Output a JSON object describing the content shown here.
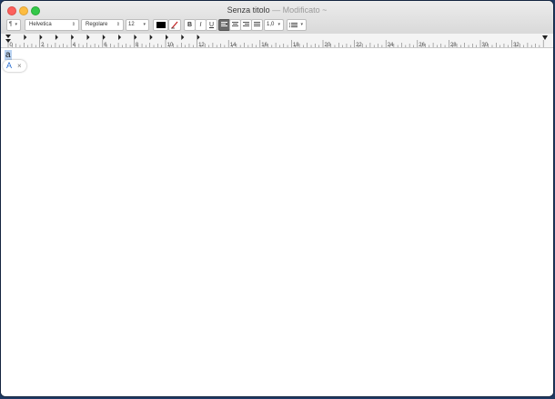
{
  "window": {
    "title": "Senza titolo",
    "modified_label": "— Modificato ~"
  },
  "toolbar": {
    "paragraph_style": "¶",
    "font_family": "Helvetica",
    "font_style": "Regolare",
    "font_size": "12",
    "text_color": "#000000",
    "bold_label": "B",
    "italic_label": "I",
    "underline_label": "U",
    "line_spacing": "1,0",
    "list_icon": "list-bullets-icon"
  },
  "ruler": {
    "labels": [
      "0",
      "2",
      "4",
      "6",
      "8",
      "10",
      "12",
      "14",
      "16",
      "18",
      "20",
      "22",
      "24",
      "26",
      "28",
      "30",
      "32"
    ]
  },
  "document": {
    "text": "a"
  },
  "popup": {
    "letter": "A",
    "close": "×"
  }
}
